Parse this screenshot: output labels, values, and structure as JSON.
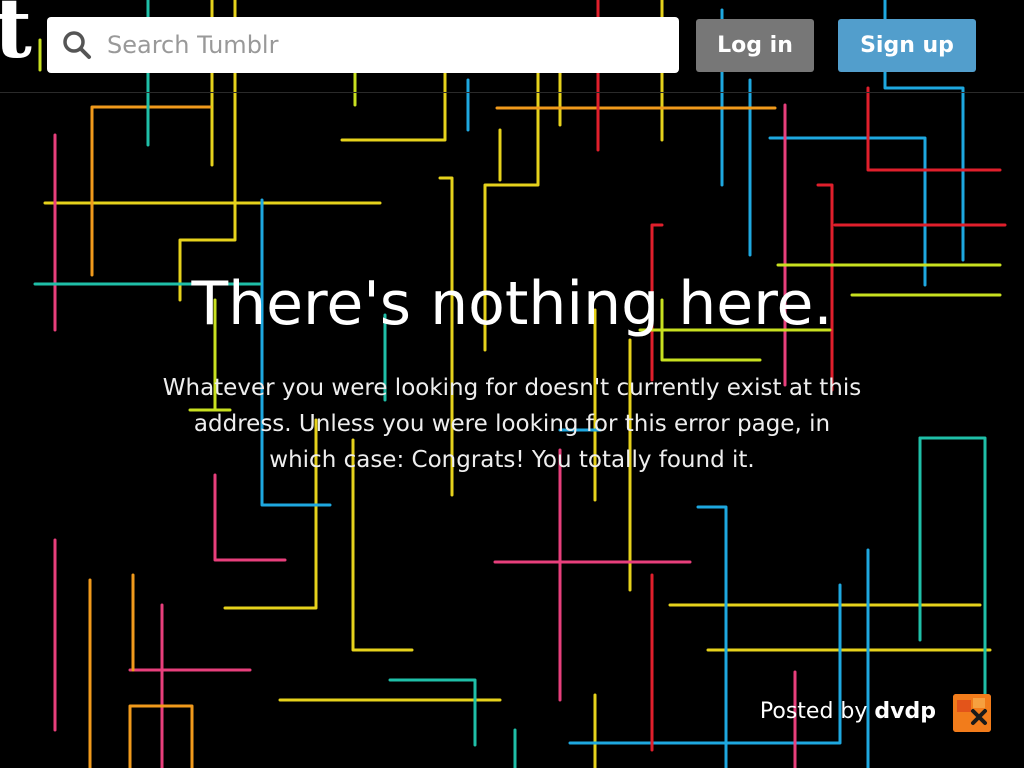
{
  "header": {
    "logo_text": "t",
    "search_placeholder": "Search Tumblr",
    "login_label": "Log in",
    "signup_label": "Sign up"
  },
  "error": {
    "title": "There's nothing here.",
    "message": "Whatever you were looking for doesn't currently exist at this address. Unless you were looking for this error page, in which case: Congrats! You totally found it."
  },
  "credit": {
    "prefix": "Posted by ",
    "username": "dvdp",
    "avatar_icon": "user-avatar-icon"
  },
  "colors": {
    "background": "#000000",
    "login_button": "#777777",
    "signup_button": "#529ecc",
    "line_yellow": "#e6d21c",
    "line_blue": "#1ea8e0",
    "line_pink": "#e83f7c",
    "line_orange": "#f09a1c",
    "line_red": "#e01f2c",
    "line_teal": "#1fbfa8",
    "line_lime": "#c8e020"
  }
}
